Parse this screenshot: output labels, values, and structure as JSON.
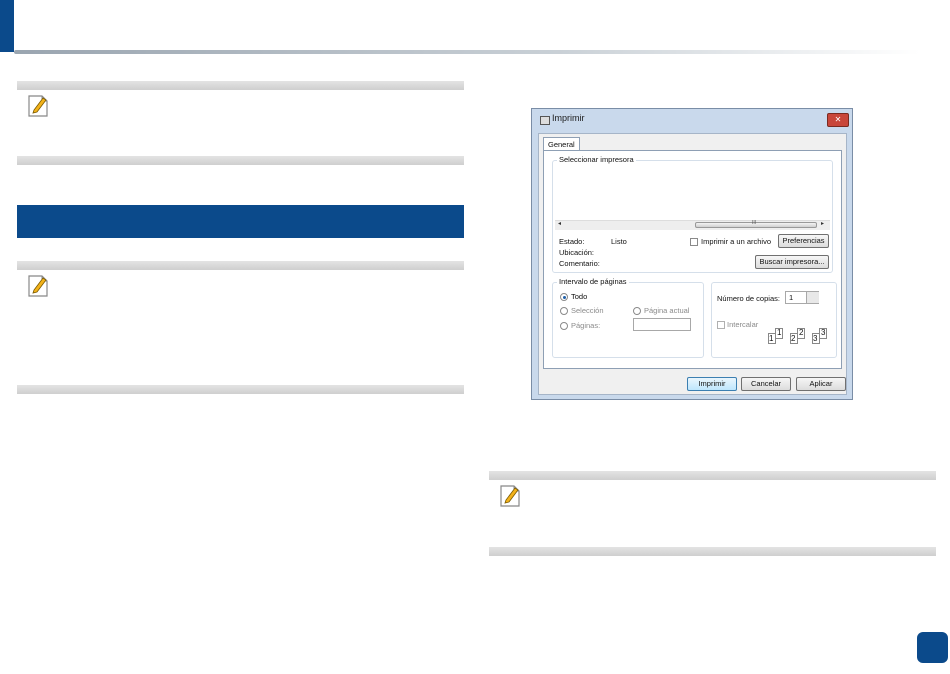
{
  "dialog": {
    "title": "Imprimir",
    "tab": "General",
    "printer_group_label": "Seleccionar impresora",
    "scroll_thumb_label": "III",
    "scroll_left": "◂",
    "scroll_right": "▸",
    "status_label": "Estado:",
    "status_value": "Listo",
    "location_label": "Ubicación:",
    "comment_label": "Comentario:",
    "print_to_file_label": "Imprimir a un archivo",
    "preferences_button": "Preferencias",
    "find_printer_button": "Buscar impresora...",
    "page_range_label": "Intervalo de páginas",
    "option_all": "Todo",
    "option_selection": "Selección",
    "option_current_page": "Página actual",
    "option_pages": "Páginas:",
    "copies_label": "Número de copias:",
    "copies_value": "1",
    "collate_label": "Intercalar",
    "collate_pages": [
      "1",
      "1",
      "2",
      "2",
      "3",
      "3"
    ],
    "print_button": "Imprimir",
    "cancel_button": "Cancelar",
    "apply_button": "Aplicar",
    "close_glyph": "✕"
  },
  "colors": {
    "brand_blue": "#0b4a8b",
    "note_bar_gray": "#d4d4d4"
  }
}
